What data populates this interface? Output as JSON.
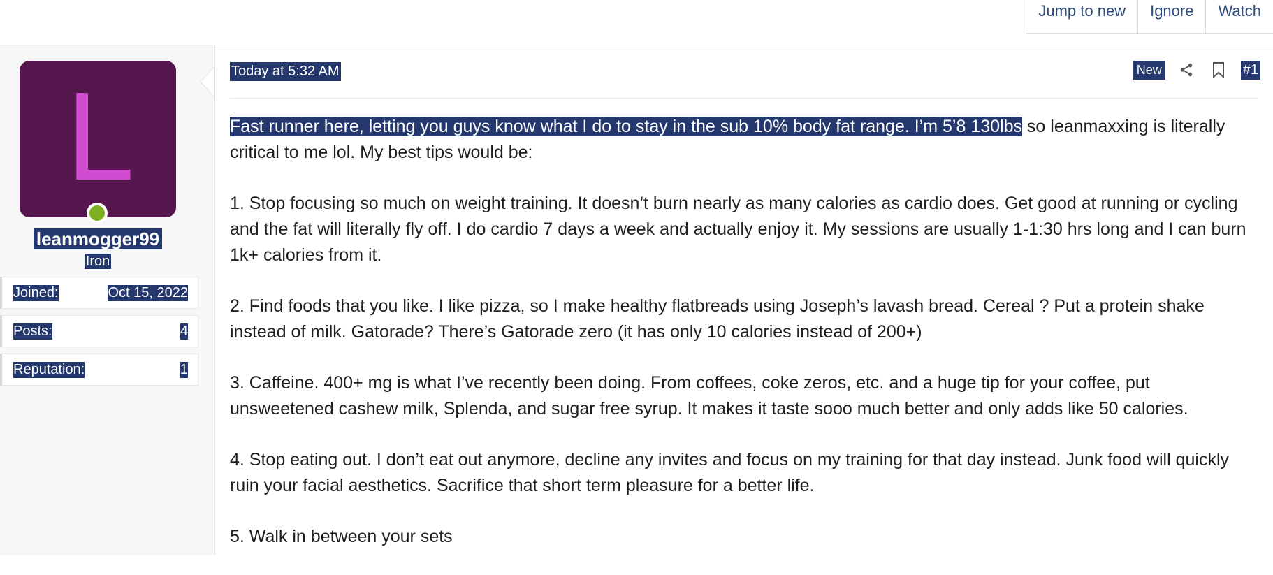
{
  "thread_actions": [
    "Jump to new",
    "Ignore",
    "Watch"
  ],
  "user": {
    "avatar_letter": "L",
    "avatar_bg": "#54164c",
    "avatar_letter_color": "#d14cd0",
    "online_status_color": "#7db11f",
    "username": "leanmogger99",
    "title": "Iron",
    "stats": [
      {
        "label": "Joined:",
        "value": "Oct 15, 2022"
      },
      {
        "label": "Posts:",
        "value": "4"
      },
      {
        "label": "Reputation:",
        "value": "1"
      }
    ]
  },
  "post": {
    "date": "Today at 5:32 AM",
    "badge": "New",
    "share_icon": "share-icon",
    "bookmark_icon": "bookmark-icon",
    "number": "#1",
    "first_line_selected": "Fast runner here, letting you guys know what I do to stay in the sub 10% body fat range. I’m 5’8 130lbs",
    "first_line_rest": " so leanmaxxing is literally critical to me lol. My best tips would be:",
    "paragraphs": [
      "1. Stop focusing so much on weight training. It doesn’t burn nearly as many calories as cardio does. Get good at running or cycling and the fat will literally fly off. I do cardio 7 days a week and actually enjoy it. My sessions are usually 1-1:30 hrs long and I can burn 1k+ calories from it.",
      "2. Find foods that you like. I like pizza, so I make healthy flatbreads using Joseph’s lavash bread. Cereal ? Put a protein shake instead of milk. Gatorade? There’s Gatorade zero (it has only 10 calories instead of 200+)",
      "3. Caffeine. 400+ mg is what I’ve recently been doing. From coffees, coke zeros, etc. and a huge tip for your coffee, put unsweetened cashew milk, Splenda, and sugar free syrup. It makes it taste sooo much better and only adds like 50 calories.",
      "4. Stop eating out. I don’t eat out anymore, decline any invites and focus on my training for that day instead. Junk food will quickly ruin your facial aesthetics. Sacrifice that short term pleasure for a better life.",
      "5. Walk in between your sets"
    ]
  },
  "colors": {
    "selection": "#24386e",
    "link": "#2d4a7c"
  }
}
